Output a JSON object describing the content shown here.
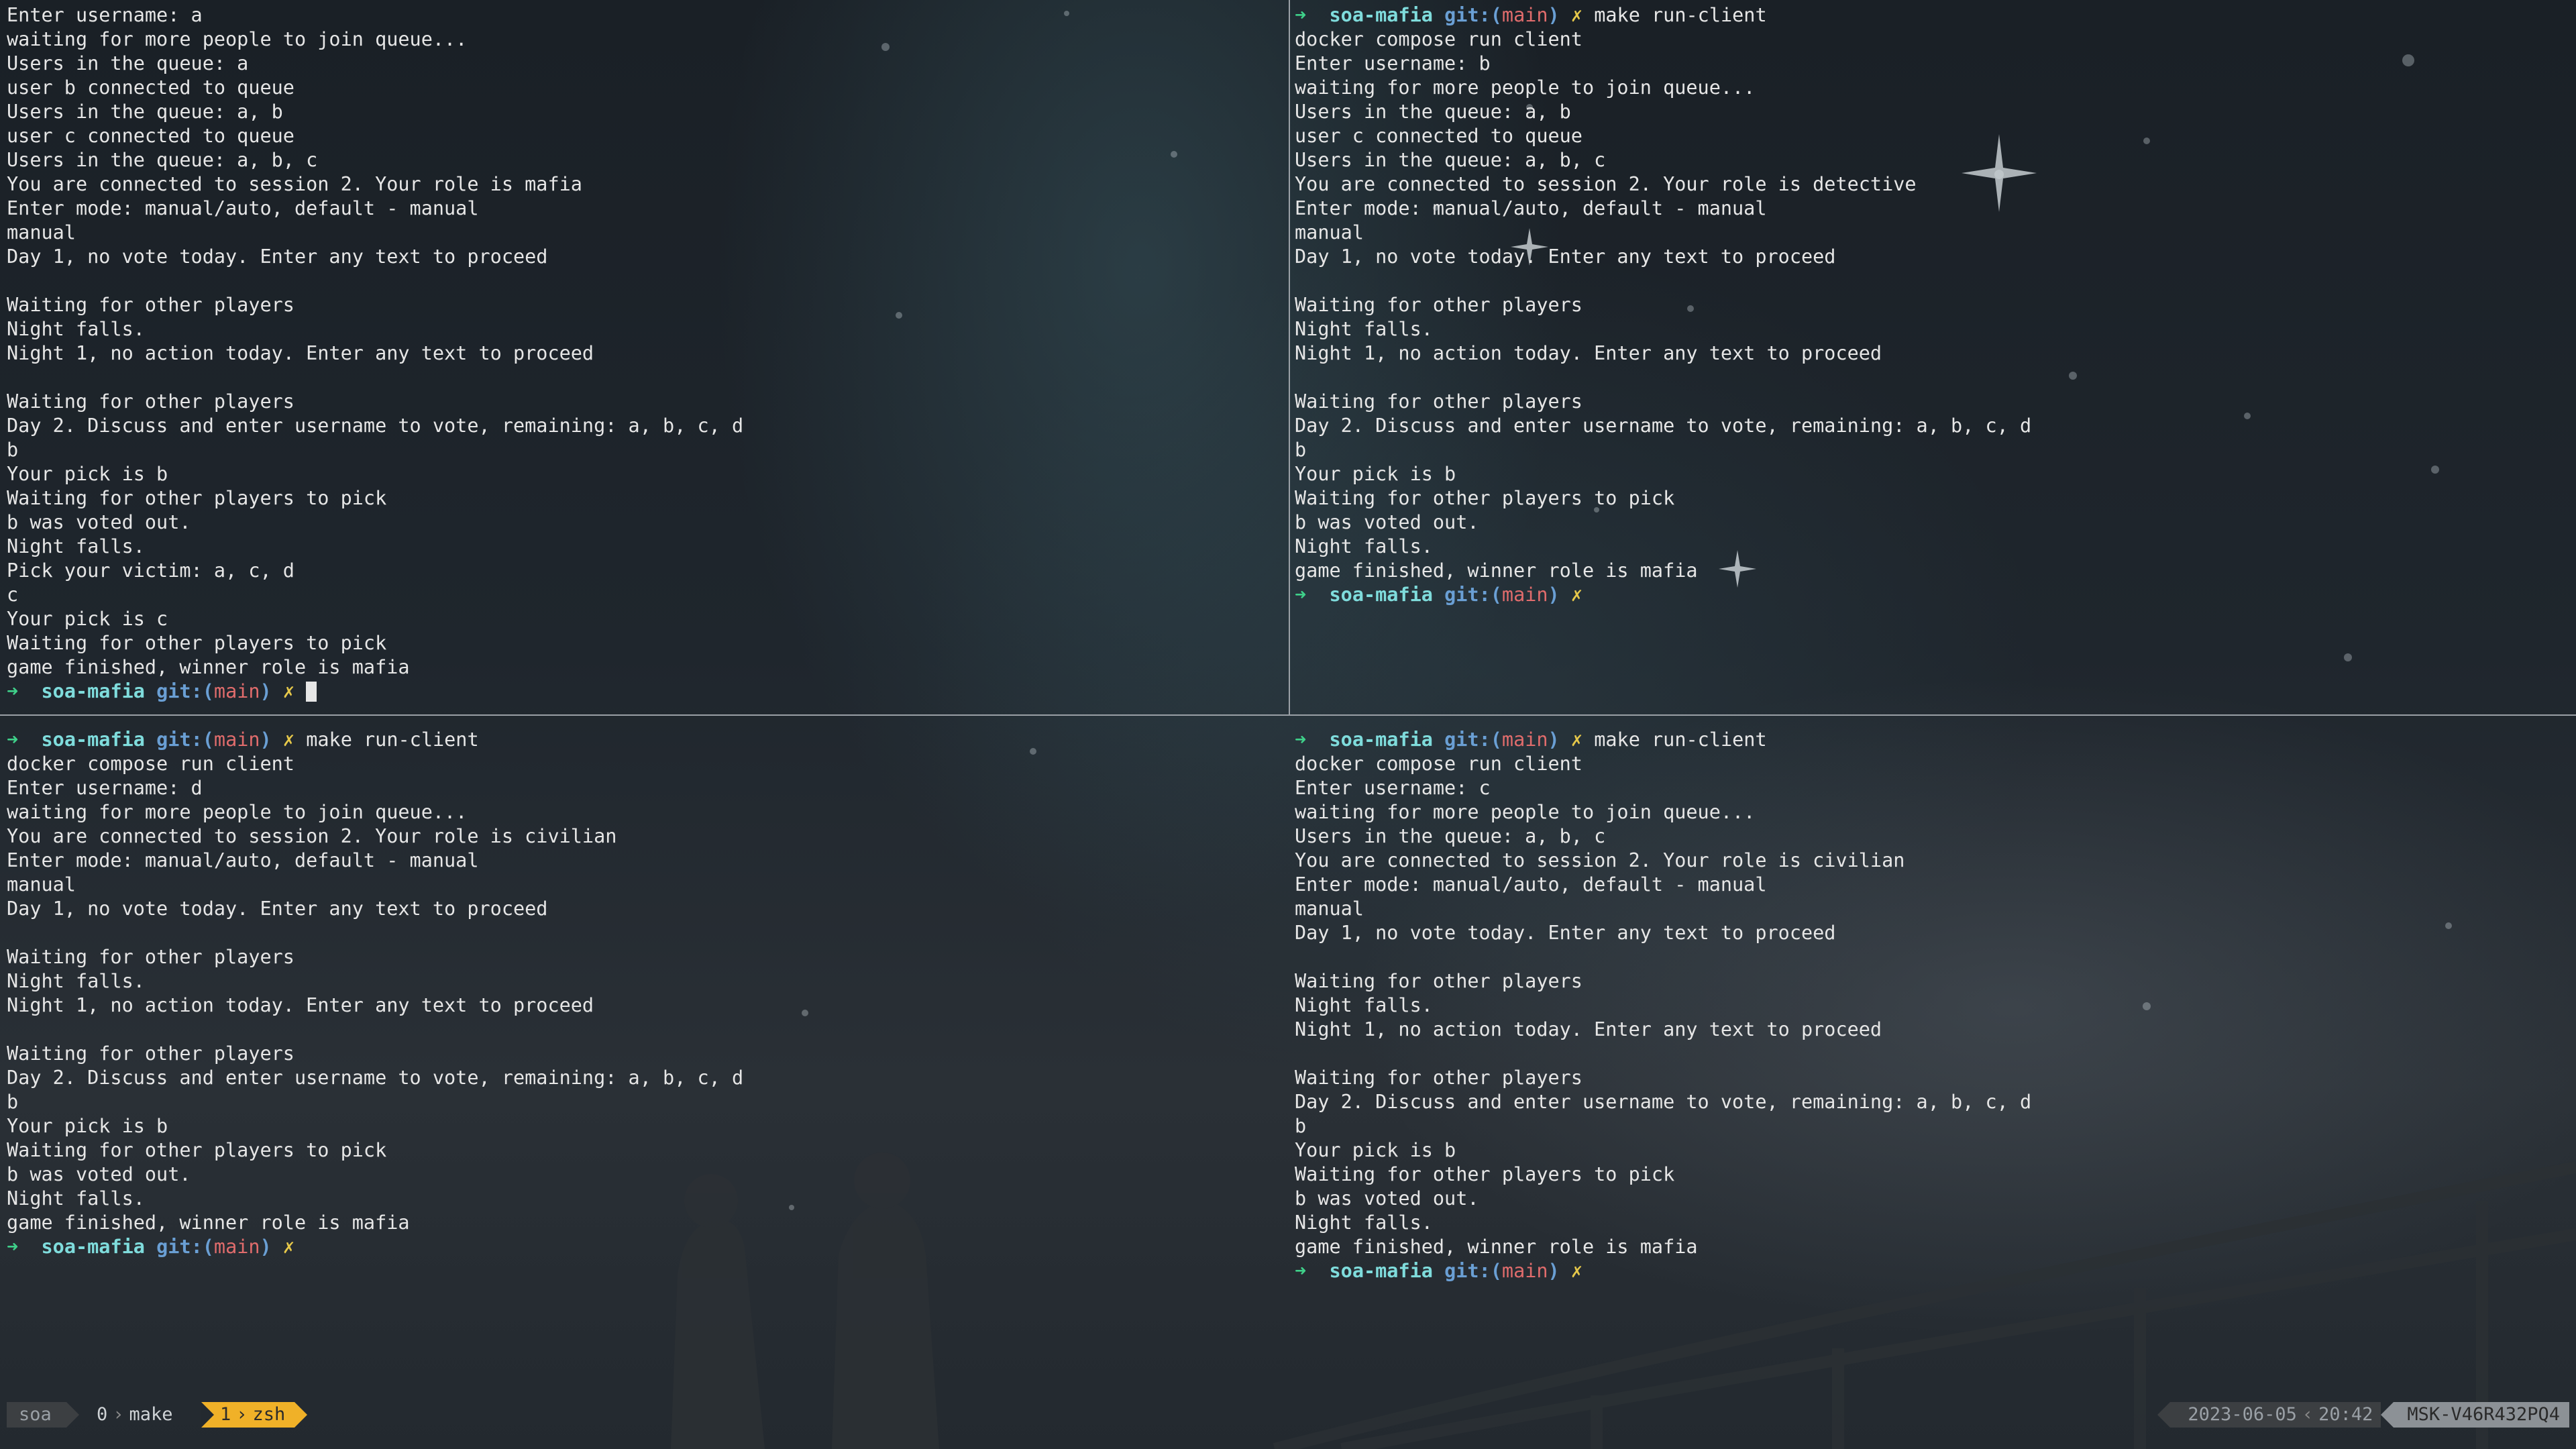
{
  "prompt": {
    "arrow": "➜",
    "dir": "soa-mafia",
    "git_prefix": "git:(",
    "branch": "main",
    "git_suffix": ")",
    "dirty": "✗"
  },
  "panes": {
    "top_left": {
      "lines": [
        "Enter username: a",
        "waiting for more people to join queue...",
        "Users in the queue: a",
        "user b connected to queue",
        "Users in the queue: a, b",
        "user c connected to queue",
        "Users in the queue: a, b, c",
        "You are connected to session 2. Your role is mafia",
        "Enter mode: manual/auto, default - manual",
        "manual",
        "Day 1, no vote today. Enter any text to proceed",
        "",
        "Waiting for other players",
        "Night falls.",
        "Night 1, no action today. Enter any text to proceed",
        "",
        "Waiting for other players",
        "Day 2. Discuss and enter username to vote, remaining: a, b, c, d",
        "b",
        "Your pick is b",
        "Waiting for other players to pick",
        "b was voted out.",
        "Night falls.",
        "Pick your victim: a, c, d",
        "c",
        "Your pick is c",
        "Waiting for other players to pick",
        "game finished, winner role is mafia"
      ]
    },
    "top_right": {
      "command": "make run-client",
      "lines": [
        "docker compose run client",
        "Enter username: b",
        "waiting for more people to join queue...",
        "Users in the queue: a, b",
        "user c connected to queue",
        "Users in the queue: a, b, c",
        "You are connected to session 2. Your role is detective",
        "Enter mode: manual/auto, default - manual",
        "manual",
        "Day 1, no vote today. Enter any text to proceed",
        "",
        "Waiting for other players",
        "Night falls.",
        "Night 1, no action today. Enter any text to proceed",
        "",
        "Waiting for other players",
        "Day 2. Discuss and enter username to vote, remaining: a, b, c, d",
        "b",
        "Your pick is b",
        "Waiting for other players to pick",
        "b was voted out.",
        "Night falls.",
        "game finished, winner role is mafia"
      ]
    },
    "bottom_left": {
      "command": "make run-client",
      "lines": [
        "docker compose run client",
        "Enter username: d",
        "waiting for more people to join queue...",
        "You are connected to session 2. Your role is civilian",
        "Enter mode: manual/auto, default - manual",
        "manual",
        "Day 1, no vote today. Enter any text to proceed",
        "",
        "Waiting for other players",
        "Night falls.",
        "Night 1, no action today. Enter any text to proceed",
        "",
        "Waiting for other players",
        "Day 2. Discuss and enter username to vote, remaining: a, b, c, d",
        "b",
        "Your pick is b",
        "Waiting for other players to pick",
        "b was voted out.",
        "Night falls.",
        "game finished, winner role is mafia"
      ]
    },
    "bottom_right": {
      "command": "make run-client",
      "lines": [
        "docker compose run client",
        "Enter username: c",
        "waiting for more people to join queue...",
        "Users in the queue: a, b, c",
        "You are connected to session 2. Your role is civilian",
        "Enter mode: manual/auto, default - manual",
        "manual",
        "Day 1, no vote today. Enter any text to proceed",
        "",
        "Waiting for other players",
        "Night falls.",
        "Night 1, no action today. Enter any text to proceed",
        "",
        "Waiting for other players",
        "Day 2. Discuss and enter username to vote, remaining: a, b, c, d",
        "b",
        "Your pick is b",
        "Waiting for other players to pick",
        "b was voted out.",
        "Night falls.",
        "game finished, winner role is mafia"
      ]
    }
  },
  "statusbar": {
    "session": "soa",
    "win0_index": "0",
    "win0_name": "make",
    "win1_index": "1",
    "win1_name": "zsh",
    "date": "2023-06-05",
    "time": "20:42",
    "host": "MSK-V46R432PQ4"
  },
  "colors": {
    "accent": "#f0b128",
    "prompt_arrow": "#3fd18a",
    "prompt_dir": "#7fdcdc",
    "git": "#6a9fd4",
    "branch": "#e06c6c",
    "dirty": "#e6c84a"
  }
}
